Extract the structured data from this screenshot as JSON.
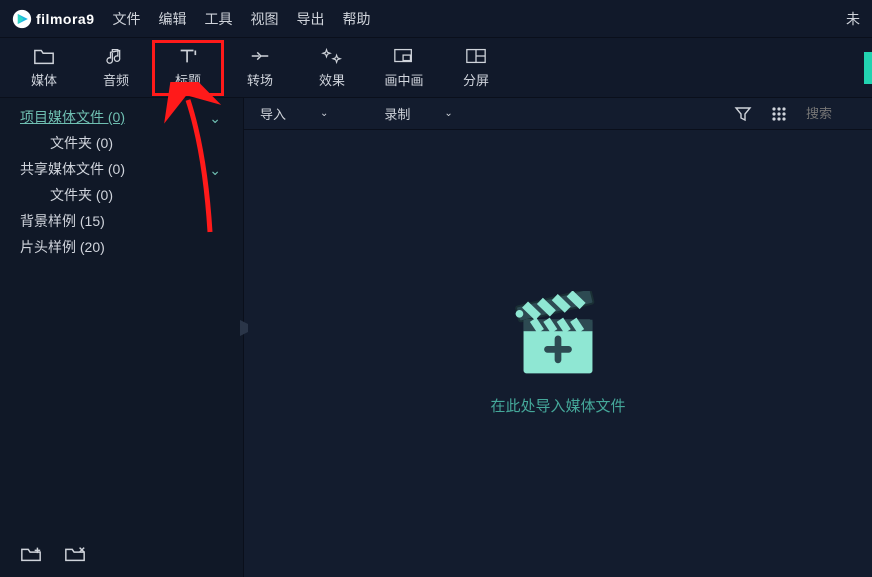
{
  "app": {
    "name": "filmora",
    "version": "9"
  },
  "menubar": {
    "items": [
      "文件",
      "编辑",
      "工具",
      "视图",
      "导出",
      "帮助"
    ],
    "right": "未"
  },
  "toolbar": {
    "items": [
      {
        "label": "媒体"
      },
      {
        "label": "音频"
      },
      {
        "label": "标题"
      },
      {
        "label": "转场"
      },
      {
        "label": "效果"
      },
      {
        "label": "画中画"
      },
      {
        "label": "分屏"
      }
    ]
  },
  "sidebar": {
    "rows": [
      {
        "label": "项目媒体文件 (0)",
        "selected": true,
        "expandable": true
      },
      {
        "label": "文件夹 (0)",
        "child": true
      },
      {
        "label": "共享媒体文件 (0)",
        "expandable": true
      },
      {
        "label": "文件夹 (0)",
        "child": true
      },
      {
        "label": "背景样例 (15)"
      },
      {
        "label": "片头样例 (20)"
      }
    ],
    "btn_new": "new-folder",
    "btn_del": "delete-folder"
  },
  "content": {
    "import_label": "导入",
    "record_label": "录制",
    "search_placeholder": "搜索",
    "drop_hint": "在此处导入媒体文件"
  },
  "colors": {
    "accent": "#22d3b0",
    "highlight": "#ff1a1a"
  }
}
